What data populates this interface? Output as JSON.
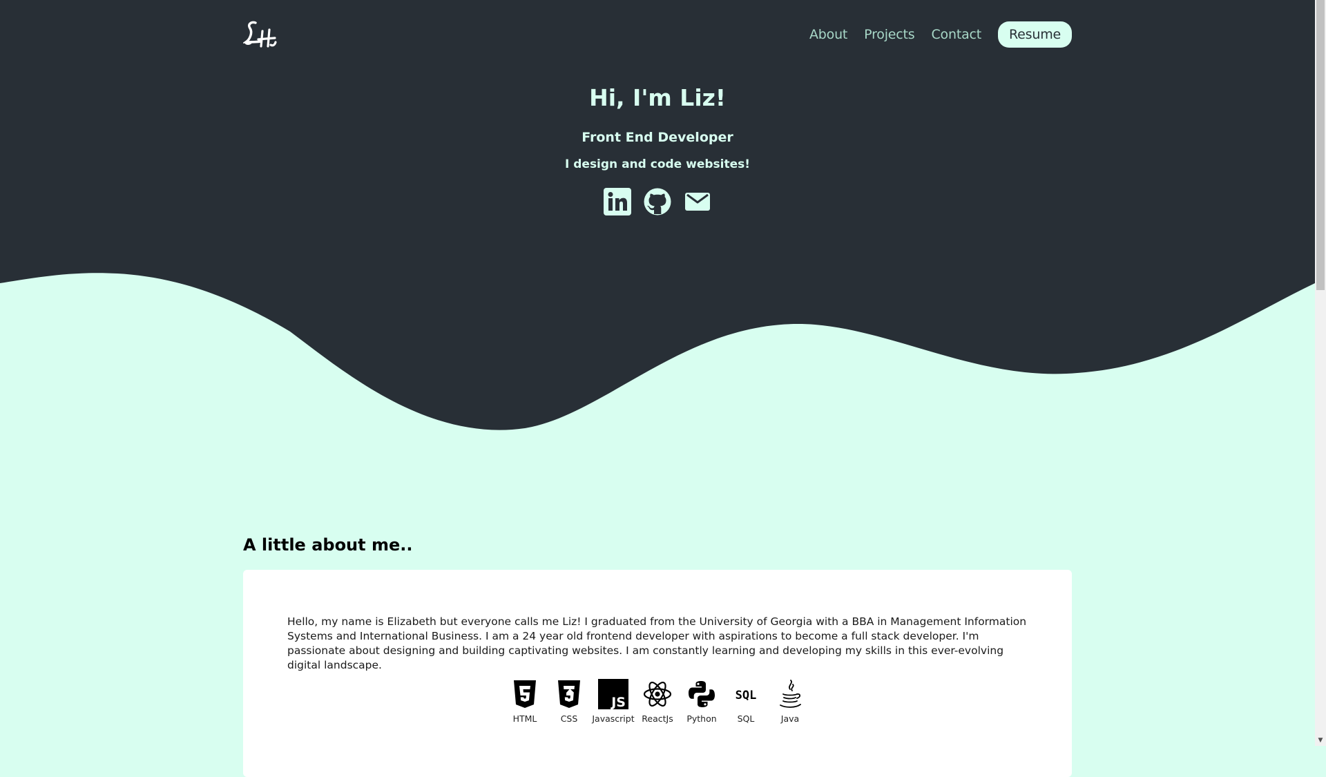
{
  "nav": {
    "logo_icon": "lh-monogram-logo",
    "links": [
      "About",
      "Projects",
      "Contact"
    ],
    "resume_label": "Resume"
  },
  "hero": {
    "title": "Hi, I'm Liz!",
    "role": "Front End Developer",
    "tagline": "I design and code websites!",
    "socials": [
      "linkedin-icon",
      "github-icon",
      "email-icon"
    ]
  },
  "about": {
    "heading": "A little about me..",
    "bio": "Hello, my name is Elizabeth but everyone calls me Liz! I graduated from the University of Georgia with a BBA in Management Information Systems and International Business. I am a 24 year old frontend developer with aspirations to become a full stack developer. I'm passionate about designing and building captivating websites. I am constantly learning and developing my skills in this ever-evolving digital landscape.",
    "skills": [
      {
        "label": "HTML",
        "icon": "html5-icon"
      },
      {
        "label": "CSS",
        "icon": "css3-icon"
      },
      {
        "label": "Javascript",
        "icon": "javascript-icon"
      },
      {
        "label": "ReactJs",
        "icon": "react-icon"
      },
      {
        "label": "Python",
        "icon": "python-icon"
      },
      {
        "label": "SQL",
        "icon": "sql-icon"
      },
      {
        "label": "Java",
        "icon": "java-icon"
      }
    ]
  },
  "colors": {
    "dark": "#282f36",
    "mint": "#d8fef0",
    "nav_link": "#a8d8c8",
    "card": "#ffffff"
  }
}
